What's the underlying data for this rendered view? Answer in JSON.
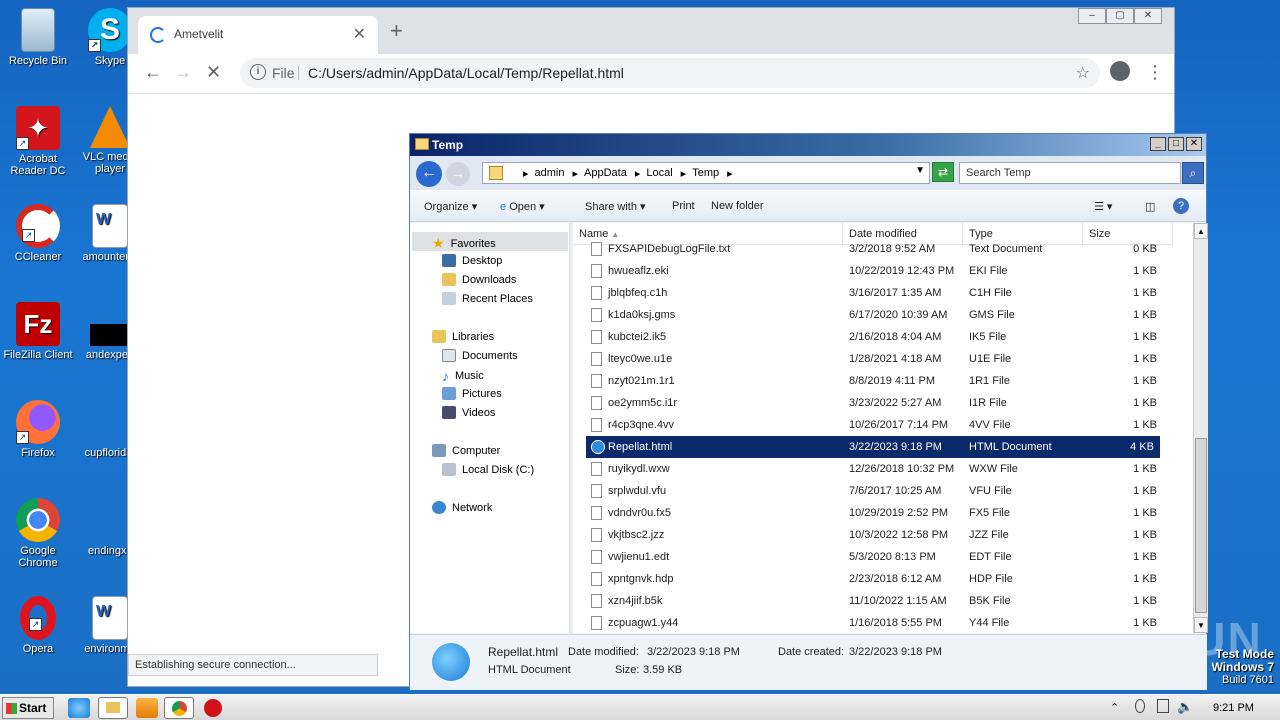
{
  "desktop_icons": [
    {
      "label": "Recycle Bin",
      "icon": "recycle-bin-icon"
    },
    {
      "label": "Skype",
      "icon": "skype-icon"
    },
    {
      "label": "Acrobat Reader DC",
      "icon": "acrobat-icon"
    },
    {
      "label": "VLC media player",
      "icon": "vlc-icon"
    },
    {
      "label": "CCleaner",
      "icon": "ccleaner-icon"
    },
    {
      "label": "amountend",
      "icon": "word-doc-icon"
    },
    {
      "label": "FileZilla Client",
      "icon": "filezilla-icon"
    },
    {
      "label": "andexperi",
      "icon": "black-file-icon"
    },
    {
      "label": "Firefox",
      "icon": "firefox-icon"
    },
    {
      "label": "cupflorida.",
      "icon": "blank-file-icon"
    },
    {
      "label": "Google Chrome",
      "icon": "chrome-icon"
    },
    {
      "label": "endingxx",
      "icon": "blank-file-icon"
    },
    {
      "label": "Opera",
      "icon": "opera-icon"
    },
    {
      "label": "environme",
      "icon": "word-doc-icon"
    }
  ],
  "chrome": {
    "tab_title": "Ametvelit",
    "close_glyph": "✕",
    "newtab_glyph": "+",
    "omnibox_scheme": "File",
    "url": "C:/Users/admin/AppData/Local/Temp/Repellat.html",
    "status": "Establishing secure connection..."
  },
  "explorer": {
    "title": "Temp",
    "breadcrumbs": [
      "admin",
      "AppData",
      "Local",
      "Temp"
    ],
    "search_placeholder": "Search Temp",
    "commands": [
      "Organize",
      "Open",
      "Share with",
      "Print",
      "New folder"
    ],
    "nav": {
      "favorites": "Favorites",
      "desktop": "Desktop",
      "downloads": "Downloads",
      "recent": "Recent Places",
      "libraries": "Libraries",
      "documents": "Documents",
      "music": "Music",
      "pictures": "Pictures",
      "videos": "Videos",
      "computer": "Computer",
      "localdisk": "Local Disk (C:)",
      "network": "Network"
    },
    "columns": [
      "Name",
      "Date modified",
      "Type",
      "Size"
    ],
    "files": [
      {
        "name": "FXSAPIDebugLogFile.txt",
        "date": "3/2/2018 9:52 AM",
        "type": "Text Document",
        "size": "0 KB"
      },
      {
        "name": "hwueaflz.eki",
        "date": "10/22/2019 12:43 PM",
        "type": "EKI File",
        "size": "1 KB"
      },
      {
        "name": "jblqbfeq.c1h",
        "date": "3/16/2017 1:35 AM",
        "type": "C1H File",
        "size": "1 KB"
      },
      {
        "name": "k1da0ksj.gms",
        "date": "6/17/2020 10:39 AM",
        "type": "GMS File",
        "size": "1 KB"
      },
      {
        "name": "kubctei2.ik5",
        "date": "2/16/2018 4:04 AM",
        "type": "IK5 File",
        "size": "1 KB"
      },
      {
        "name": "lteyc0we.u1e",
        "date": "1/28/2021 4:18 AM",
        "type": "U1E File",
        "size": "1 KB"
      },
      {
        "name": "nzyt021m.1r1",
        "date": "8/8/2019 4:11 PM",
        "type": "1R1 File",
        "size": "1 KB"
      },
      {
        "name": "oe2ymm5c.i1r",
        "date": "3/23/2022 5:27 AM",
        "type": "I1R File",
        "size": "1 KB"
      },
      {
        "name": "r4cp3qne.4vv",
        "date": "10/26/2017 7:14 PM",
        "type": "4VV File",
        "size": "1 KB"
      },
      {
        "name": "Repellat.html",
        "date": "3/22/2023 9:18 PM",
        "type": "HTML Document",
        "size": "4 KB"
      },
      {
        "name": "ruyikydl.wxw",
        "date": "12/26/2018 10:32 PM",
        "type": "WXW File",
        "size": "1 KB"
      },
      {
        "name": "srplwdul.vfu",
        "date": "7/6/2017 10:25 AM",
        "type": "VFU File",
        "size": "1 KB"
      },
      {
        "name": "vdndvr0u.fx5",
        "date": "10/29/2019 2:52 PM",
        "type": "FX5 File",
        "size": "1 KB"
      },
      {
        "name": "vkjtbsc2.jzz",
        "date": "10/3/2022 12:58 PM",
        "type": "JZZ File",
        "size": "1 KB"
      },
      {
        "name": "vwjienu1.edt",
        "date": "5/3/2020 8:13 PM",
        "type": "EDT File",
        "size": "1 KB"
      },
      {
        "name": "xpntgnvk.hdp",
        "date": "2/23/2018 6:12 AM",
        "type": "HDP File",
        "size": "1 KB"
      },
      {
        "name": "xzn4jiif.b5k",
        "date": "11/10/2022 1:15 AM",
        "type": "B5K File",
        "size": "1 KB"
      },
      {
        "name": "zcpuagw1.y44",
        "date": "1/16/2018 5:55 PM",
        "type": "Y44 File",
        "size": "1 KB"
      }
    ],
    "selected_index": 9,
    "details": {
      "name": "Repellat.html",
      "type": "HTML Document",
      "date_modified_label": "Date modified:",
      "date_modified": "3/22/2023 9:18 PM",
      "date_created_label": "Date created:",
      "date_created": "3/22/2023 9:18 PM",
      "size_label": "Size:",
      "size": "3.59 KB"
    }
  },
  "taskbar": {
    "start": "Start",
    "clock": "9:21 PM"
  },
  "watermark": {
    "line1": "Test Mode",
    "line2": "Windows 7",
    "line3": "Build 7601",
    "brand": "ANY RUN"
  }
}
